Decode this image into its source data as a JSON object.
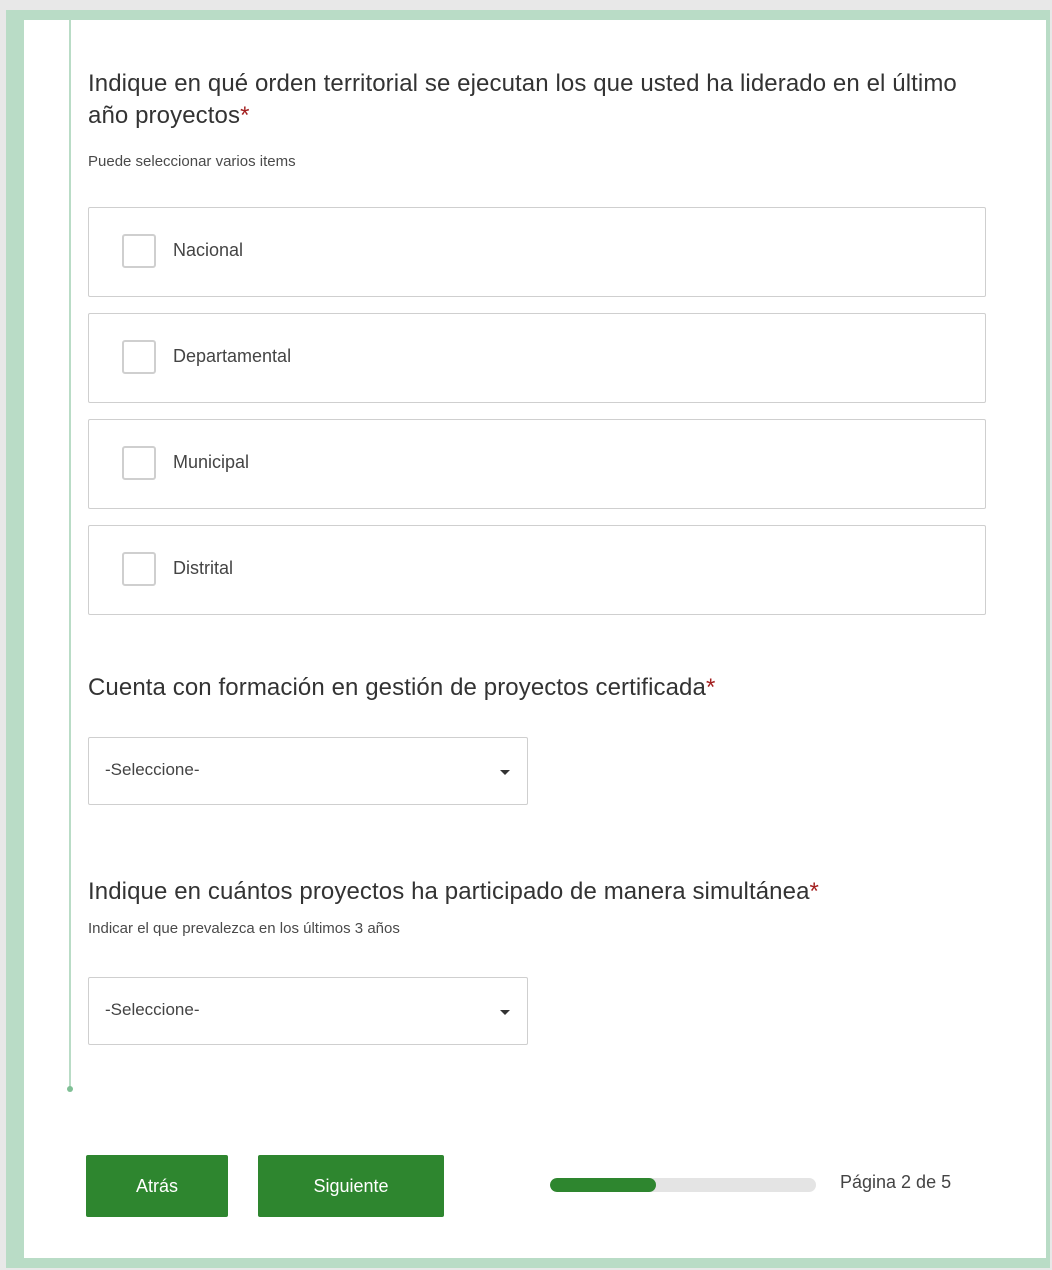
{
  "question1": {
    "title": "Indique en qué orden territorial se ejecutan los que usted ha liderado en el último año proyectos",
    "required_mark": "*",
    "hint": "Puede seleccionar varios items",
    "options": [
      {
        "label": "Nacional",
        "checked": false
      },
      {
        "label": "Departamental",
        "checked": false
      },
      {
        "label": "Municipal",
        "checked": false
      },
      {
        "label": "Distrital",
        "checked": false
      }
    ]
  },
  "question2": {
    "title": "Cuenta con formación en gestión de proyectos certificada",
    "required_mark": "*",
    "select_value": "-Seleccione-"
  },
  "question3": {
    "title": "Indique en cuántos proyectos ha participado de manera simultánea",
    "required_mark": "*",
    "hint": "Indicar el que prevalezca en los últimos 3 años",
    "select_value": "-Seleccione-"
  },
  "navigation": {
    "back_label": "Atrás",
    "next_label": "Siguiente",
    "progress_fraction": 0.4,
    "page_label": "Página 2 de 5"
  },
  "colors": {
    "accent": "#2e862f",
    "frame": "#b9dcc6",
    "required": "#a31f1f"
  },
  "icons": {
    "dropdown": "caret-down-icon",
    "checkbox": "checkbox-empty-icon"
  }
}
